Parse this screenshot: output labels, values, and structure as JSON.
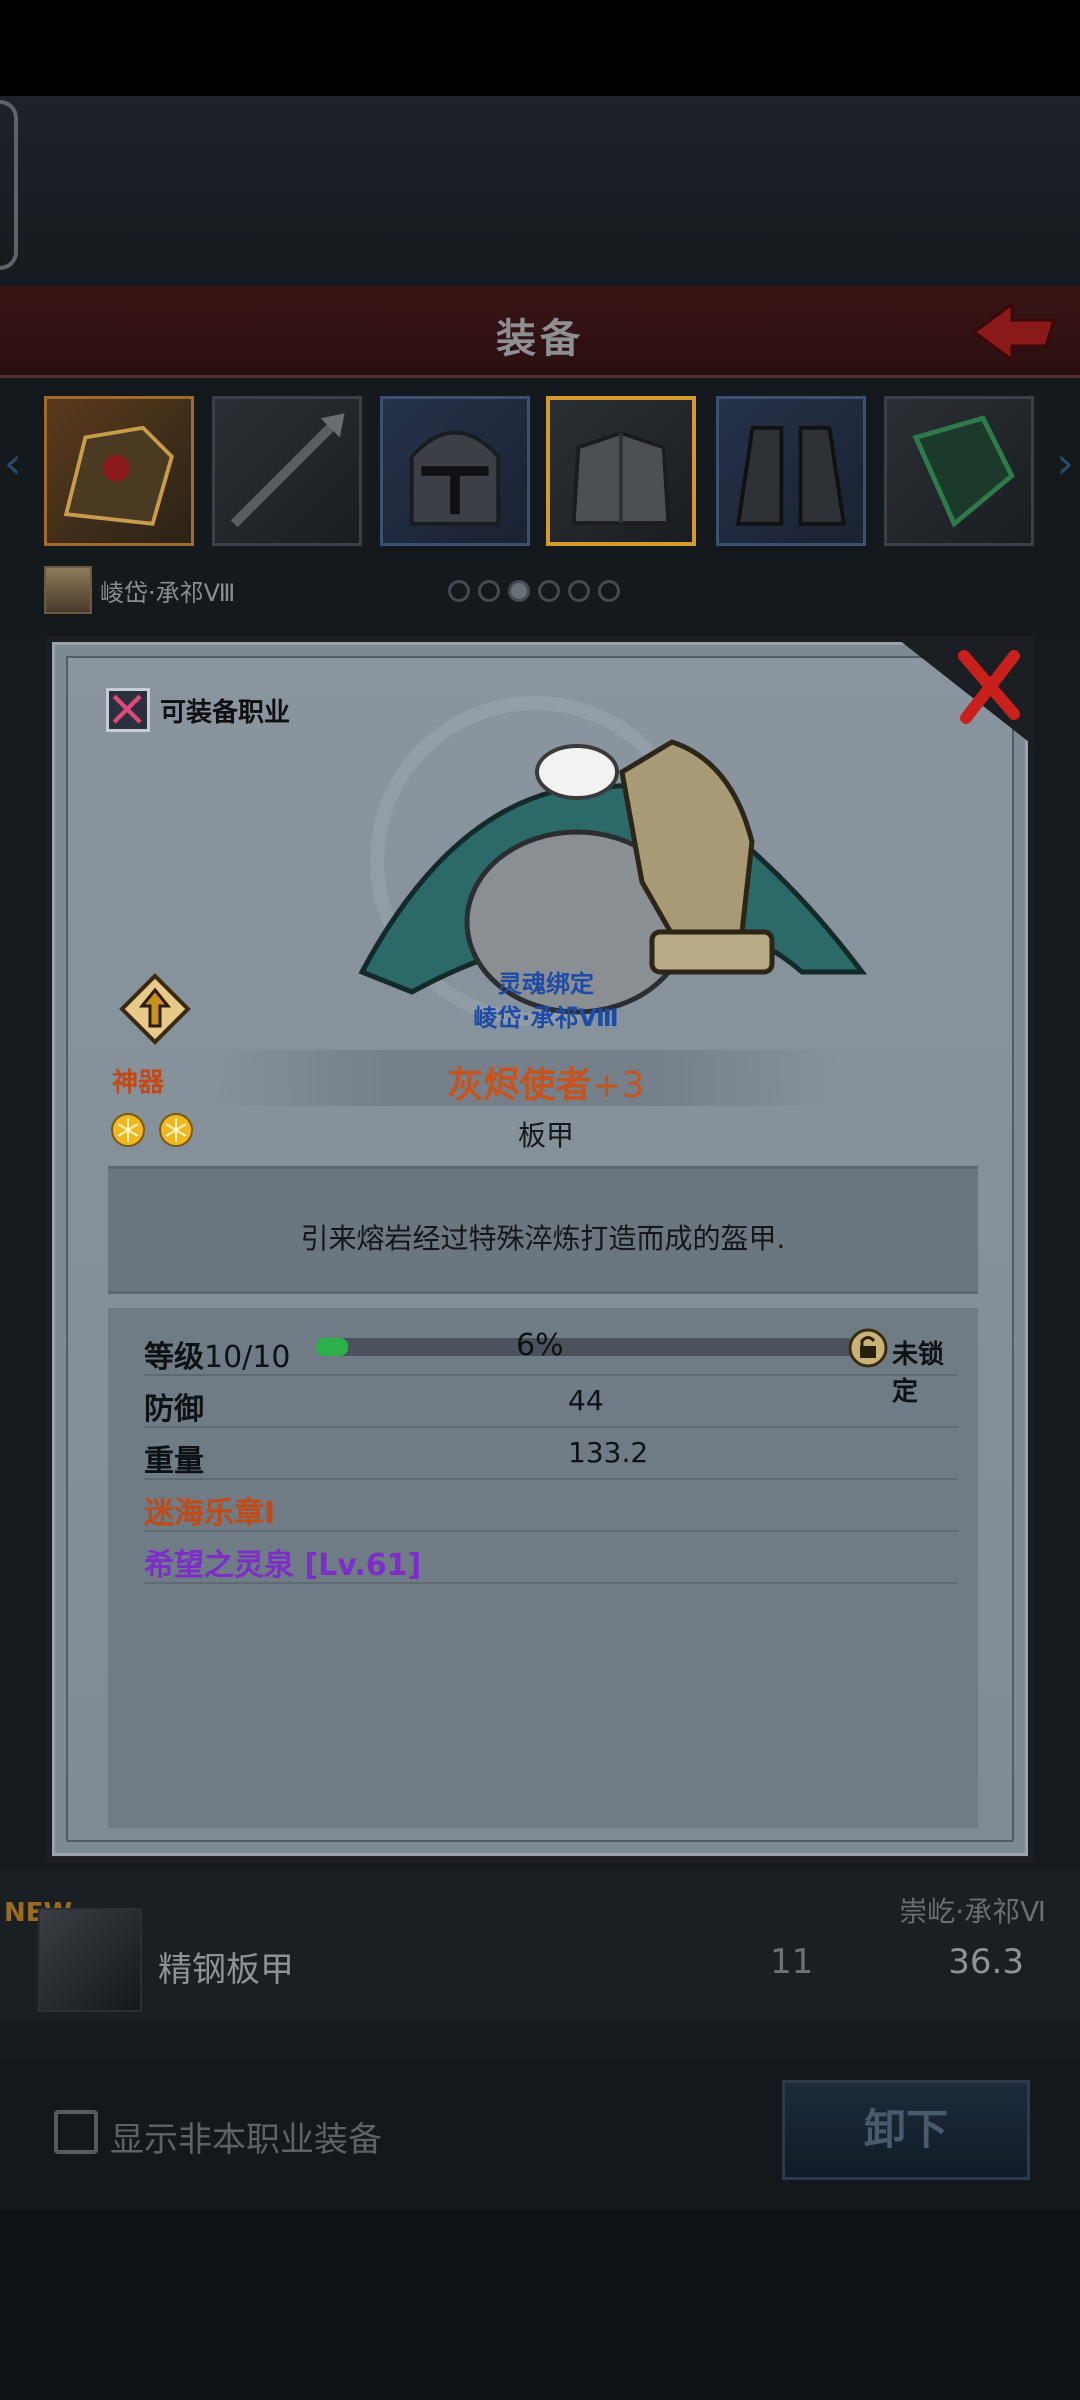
{
  "screen": {
    "title": "装备",
    "hero_name": "崚岱·承祁Ⅷ",
    "equip_slots": [
      "shoulder-armor",
      "spear",
      "helmet",
      "chest-armor",
      "greaves",
      "gauntlet"
    ],
    "page_dots": 6,
    "page_active": 2
  },
  "list_item": {
    "new_tag": "NEW",
    "name": "精钢板甲",
    "owner": "崇屹·承祁Ⅵ",
    "value_a": "11",
    "value_b": "36.3"
  },
  "bottom": {
    "checkbox_label": "显示非本职业装备",
    "unequip_label": "卸下"
  },
  "dialog": {
    "equip_class_label": "可装备职业",
    "soul_bound": "灵魂绑定",
    "soul_owner": "崚岱·承祁Ⅷ",
    "rarity_label": "神器",
    "star_count": 2,
    "item_name": "灰烬使者",
    "enhance": "+3",
    "item_type": "板甲",
    "description": "引来熔岩经过特殊淬炼打造而成的盔甲.",
    "level_label": "等级",
    "level_value": "10/10",
    "xp_percent": "6%",
    "xp_fraction": 0.06,
    "lock_status": "未锁定",
    "stats": [
      {
        "label": "防御",
        "value": "44"
      },
      {
        "label": "重量",
        "value": "133.2"
      }
    ],
    "set_bonus": "迷海乐章Ⅰ",
    "gem": "希望之灵泉 [Lv.61]",
    "colors": {
      "rarity": "#c34a16",
      "soul": "#1e4aa8",
      "gem": "#7d2ec8",
      "xp": "#2bb04a"
    }
  }
}
